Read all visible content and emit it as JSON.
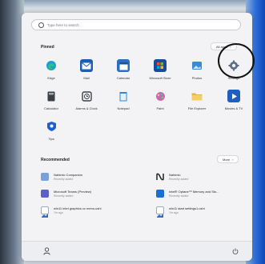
{
  "search": {
    "placeholder": "Type here to search"
  },
  "pinned": {
    "title": "Pinned",
    "all_apps_label": "All apps",
    "apps": [
      {
        "label": "Edge",
        "icon": "edge-icon",
        "color": "#1a9bd7"
      },
      {
        "label": "Mail",
        "icon": "mail-icon",
        "color": "#1c5fb8"
      },
      {
        "label": "Calendar",
        "icon": "calendar-icon",
        "color": "#2b6cc4"
      },
      {
        "label": "Microsoft Store",
        "icon": "store-icon",
        "color": "#1a4a9a"
      },
      {
        "label": "Photos",
        "icon": "photos-icon",
        "color": "#3a8bd6"
      },
      {
        "label": "Settings",
        "icon": "gear-icon",
        "color": "#5a6e8a"
      },
      {
        "label": "Calculator",
        "icon": "calculator-icon",
        "color": "#3b3f46"
      },
      {
        "label": "Alarms & Clock",
        "icon": "alarm-icon",
        "color": "#3a4048"
      },
      {
        "label": "Notepad",
        "icon": "notepad-icon",
        "color": "#2a8ae0"
      },
      {
        "label": "Paint",
        "icon": "paint-icon",
        "color": "#c46bb0"
      },
      {
        "label": "File Explorer",
        "icon": "folder-icon",
        "color": "#e7b63f"
      },
      {
        "label": "Movies & TV",
        "icon": "movies-icon",
        "color": "#1f5fbf"
      },
      {
        "label": "Tips",
        "icon": "tips-icon",
        "color": "#1a5fd0"
      }
    ]
  },
  "recommended": {
    "title": "Recommended",
    "more_label": "More",
    "items": [
      {
        "name": "Nahimic Companion",
        "sub": "Recently added",
        "icon": "nahimic-icon",
        "color": "#7aa0d8"
      },
      {
        "name": "Nahimic",
        "sub": "Recently added",
        "icon": "nahimic-logo-icon",
        "color": "#222222"
      },
      {
        "name": "Microsoft Teams (Preview)",
        "sub": "Recently added",
        "icon": "teams-icon",
        "color": "#5b5fc7"
      },
      {
        "name": "Intel® Optane™ Memory and Sto...",
        "sub": "Recently added",
        "icon": "intel-icon",
        "color": "#1a6fd0"
      },
      {
        "name": "win11 intel graphics cc menu.ushi",
        "sub": "7m ago",
        "icon": "image-file-icon",
        "color": "#2f6fc8"
      },
      {
        "name": "win11 start settings1.ushi",
        "sub": "7m ago",
        "icon": "image-file-icon",
        "color": "#2f6fc8"
      }
    ]
  },
  "user": {
    "icon": "user-icon"
  },
  "power": {
    "icon": "power-icon"
  }
}
